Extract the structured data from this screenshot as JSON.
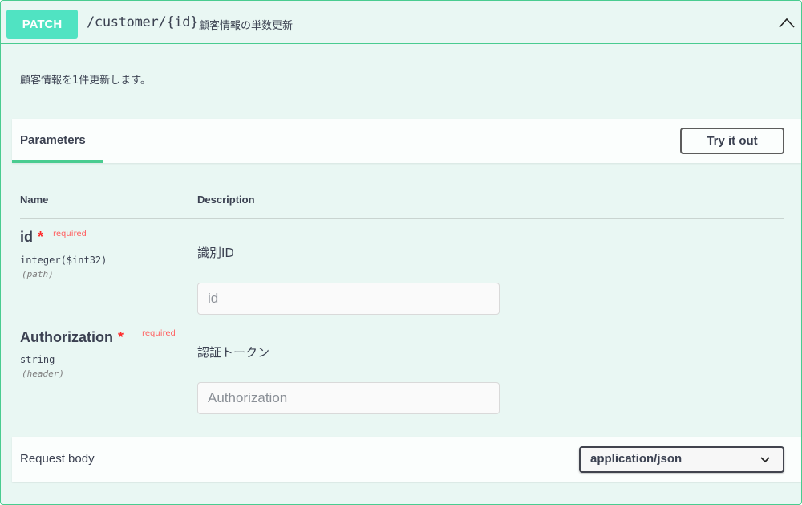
{
  "operation": {
    "method": "PATCH",
    "path": "/customer/{id}",
    "summary": "顧客情報の単数更新",
    "description": "顧客情報を1件更新します。"
  },
  "parameters_section": {
    "tab_label": "Parameters",
    "try_button_label": "Try it out",
    "col_name": "Name",
    "col_description": "Description",
    "required_label": "required",
    "required_star": "*",
    "items": [
      {
        "name": "id",
        "type": "integer($int32)",
        "in": "(path)",
        "description": "識別ID",
        "placeholder": "id"
      },
      {
        "name": "Authorization",
        "type": "string",
        "in": "(header)",
        "description": "認証トークン",
        "placeholder": "Authorization"
      }
    ]
  },
  "request_body": {
    "title": "Request body",
    "content_type": "application/json"
  },
  "colors": {
    "method_badge": "#50e3c2",
    "border": "#49cc90",
    "background": "#e9f7f3",
    "required": "#ff2a2a"
  },
  "icons": {
    "collapse": "chevron-up-icon",
    "select": "chevron-down-icon"
  }
}
